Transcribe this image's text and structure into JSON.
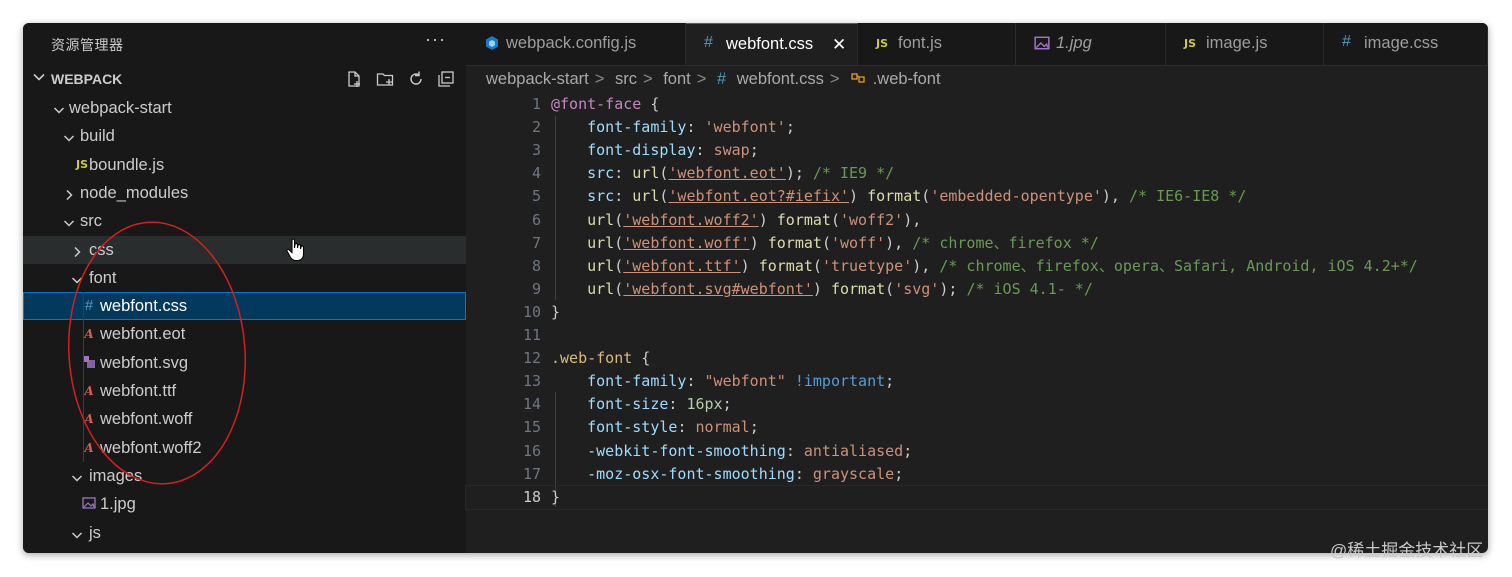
{
  "sidebar": {
    "title": "资源管理器",
    "more": "···",
    "section": "WEBPACK",
    "tree": [
      {
        "label": "webpack-start",
        "icon": "folder-open",
        "level": 0
      },
      {
        "label": "build",
        "icon": "folder-open",
        "level": 1
      },
      {
        "label": "boundle.js",
        "icon": "js-file-icon",
        "badge": "JS",
        "level": 2
      },
      {
        "label": "node_modules",
        "icon": "folder-closed",
        "level": 1
      },
      {
        "label": "src",
        "icon": "folder-open",
        "level": 1
      },
      {
        "label": "css",
        "icon": "folder-closed",
        "level": 2
      },
      {
        "label": "font",
        "icon": "folder-open",
        "level": 2
      },
      {
        "label": "webfont.css",
        "icon": "css-file-icon",
        "badge": "#",
        "level": 3,
        "selected": true
      },
      {
        "label": "webfont.eot",
        "icon": "font-file-icon",
        "badge": "A",
        "level": 3
      },
      {
        "label": "webfont.svg",
        "icon": "svg-file-icon",
        "level": 3
      },
      {
        "label": "webfont.ttf",
        "icon": "font-file-icon",
        "badge": "A",
        "level": 3
      },
      {
        "label": "webfont.woff",
        "icon": "font-file-icon",
        "badge": "A",
        "level": 3
      },
      {
        "label": "webfont.woff2",
        "icon": "font-file-icon",
        "badge": "A",
        "level": 3
      },
      {
        "label": "images",
        "icon": "folder-open",
        "level": 2
      },
      {
        "label": "1.jpg",
        "icon": "image-file-icon",
        "level": 3
      },
      {
        "label": "js",
        "icon": "folder-open",
        "level": 2
      }
    ]
  },
  "tabs": [
    {
      "label": "webpack.config.js",
      "icon": "webpack-icon"
    },
    {
      "label": "webfont.css",
      "icon": "css-file-icon",
      "badge": "#",
      "active": true
    },
    {
      "label": "font.js",
      "icon": "js-file-icon",
      "badge": "JS"
    },
    {
      "label": "1.jpg",
      "icon": "image-file-icon"
    },
    {
      "label": "image.js",
      "icon": "js-file-icon",
      "badge": "JS"
    },
    {
      "label": "image.css",
      "icon": "css-file-icon",
      "badge": "#"
    }
  ],
  "breadcrumb": {
    "parts": [
      "webpack-start",
      "src",
      "font"
    ],
    "file_badge": "#",
    "file": "webfont.css",
    "symbol": ".web-font",
    "separator": ">"
  },
  "code": {
    "current_line": 18,
    "lines": [
      [
        [
          "at",
          "@font-face"
        ],
        [
          "p",
          " {"
        ]
      ],
      [
        [
          "p",
          "    "
        ],
        [
          "prop",
          "font-family"
        ],
        [
          "p",
          ": "
        ],
        [
          "str",
          "'webfont'"
        ],
        [
          "p",
          ";"
        ]
      ],
      [
        [
          "p",
          "    "
        ],
        [
          "prop",
          "font-display"
        ],
        [
          "p",
          ": "
        ],
        [
          "str",
          "swap"
        ],
        [
          "p",
          ";"
        ]
      ],
      [
        [
          "p",
          "    "
        ],
        [
          "prop",
          "src"
        ],
        [
          "p",
          ": "
        ],
        [
          "func",
          "url"
        ],
        [
          "p",
          "("
        ],
        [
          "url",
          "'webfont.eot'"
        ],
        [
          "p",
          "); "
        ],
        [
          "com",
          "/* IE9 */"
        ]
      ],
      [
        [
          "p",
          "    "
        ],
        [
          "prop",
          "src"
        ],
        [
          "p",
          ": "
        ],
        [
          "func",
          "url"
        ],
        [
          "p",
          "("
        ],
        [
          "url",
          "'webfont.eot?#iefix'"
        ],
        [
          "p",
          ") "
        ],
        [
          "func",
          "format"
        ],
        [
          "p",
          "("
        ],
        [
          "str",
          "'embedded-opentype'"
        ],
        [
          "p",
          "), "
        ],
        [
          "com",
          "/* IE6-IE8 */"
        ]
      ],
      [
        [
          "p",
          "    "
        ],
        [
          "func",
          "url"
        ],
        [
          "p",
          "("
        ],
        [
          "url",
          "'webfont.woff2'"
        ],
        [
          "p",
          ") "
        ],
        [
          "func",
          "format"
        ],
        [
          "p",
          "("
        ],
        [
          "str",
          "'woff2'"
        ],
        [
          "p",
          "),"
        ]
      ],
      [
        [
          "p",
          "    "
        ],
        [
          "func",
          "url"
        ],
        [
          "p",
          "("
        ],
        [
          "url",
          "'webfont.woff'"
        ],
        [
          "p",
          ") "
        ],
        [
          "func",
          "format"
        ],
        [
          "p",
          "("
        ],
        [
          "str",
          "'woff'"
        ],
        [
          "p",
          "), "
        ],
        [
          "com",
          "/* chrome、firefox */"
        ]
      ],
      [
        [
          "p",
          "    "
        ],
        [
          "func",
          "url"
        ],
        [
          "p",
          "("
        ],
        [
          "url",
          "'webfont.ttf'"
        ],
        [
          "p",
          ") "
        ],
        [
          "func",
          "format"
        ],
        [
          "p",
          "("
        ],
        [
          "str",
          "'truetype'"
        ],
        [
          "p",
          "), "
        ],
        [
          "com",
          "/* chrome、firefox、opera、Safari, Android, iOS 4.2+*/"
        ]
      ],
      [
        [
          "p",
          "    "
        ],
        [
          "func",
          "url"
        ],
        [
          "p",
          "("
        ],
        [
          "url",
          "'webfont.svg#webfont'"
        ],
        [
          "p",
          ") "
        ],
        [
          "func",
          "format"
        ],
        [
          "p",
          "("
        ],
        [
          "str",
          "'svg'"
        ],
        [
          "p",
          "); "
        ],
        [
          "com",
          "/* iOS 4.1- */"
        ]
      ],
      [
        [
          "p",
          "}"
        ]
      ],
      [],
      [
        [
          "sel",
          ".web-font"
        ],
        [
          "p",
          " {"
        ]
      ],
      [
        [
          "p",
          "    "
        ],
        [
          "prop",
          "font-family"
        ],
        [
          "p",
          ": "
        ],
        [
          "str",
          "\"webfont\""
        ],
        [
          "p",
          " "
        ],
        [
          "imp",
          "!important"
        ],
        [
          "p",
          ";"
        ]
      ],
      [
        [
          "p",
          "    "
        ],
        [
          "prop",
          "font-size"
        ],
        [
          "p",
          ": "
        ],
        [
          "num",
          "16px"
        ],
        [
          "p",
          ";"
        ]
      ],
      [
        [
          "p",
          "    "
        ],
        [
          "prop",
          "font-style"
        ],
        [
          "p",
          ": "
        ],
        [
          "str",
          "normal"
        ],
        [
          "p",
          ";"
        ]
      ],
      [
        [
          "p",
          "    "
        ],
        [
          "prop",
          "-webkit-font-smoothing"
        ],
        [
          "p",
          ": "
        ],
        [
          "str",
          "antialiased"
        ],
        [
          "p",
          ";"
        ]
      ],
      [
        [
          "p",
          "    "
        ],
        [
          "prop",
          "-moz-osx-font-smoothing"
        ],
        [
          "p",
          ": "
        ],
        [
          "str",
          "grayscale"
        ],
        [
          "p",
          ";"
        ]
      ],
      [
        [
          "p",
          "}"
        ]
      ]
    ]
  },
  "watermark": "@稀土掘金技术社区",
  "colors": {
    "accent": "#0078d4",
    "annotation": "#d42020",
    "sidebar_bg": "#181818",
    "editor_bg": "#1f1f1f"
  }
}
